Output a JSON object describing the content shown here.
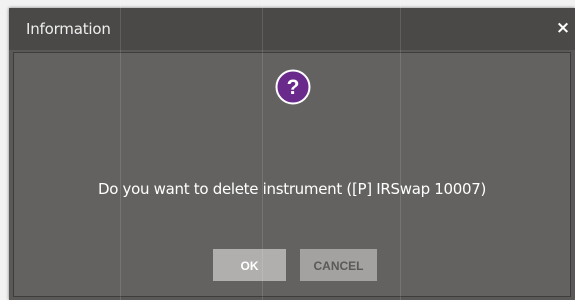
{
  "dialog": {
    "title": "Information",
    "close_glyph": "×",
    "icon": "question-circle-icon",
    "message": "Do you want to delete instrument ([P] IRSwap 10007)",
    "buttons": {
      "ok_label": "OK",
      "cancel_label": "CANCEL"
    }
  },
  "colors": {
    "dialog_bg": "#5a5958",
    "titlebar_bg": "#4a4948",
    "icon_accent": "#6a2a8c",
    "ok_bg": "#b0afae",
    "cancel_bg": "#a3a2a1"
  }
}
